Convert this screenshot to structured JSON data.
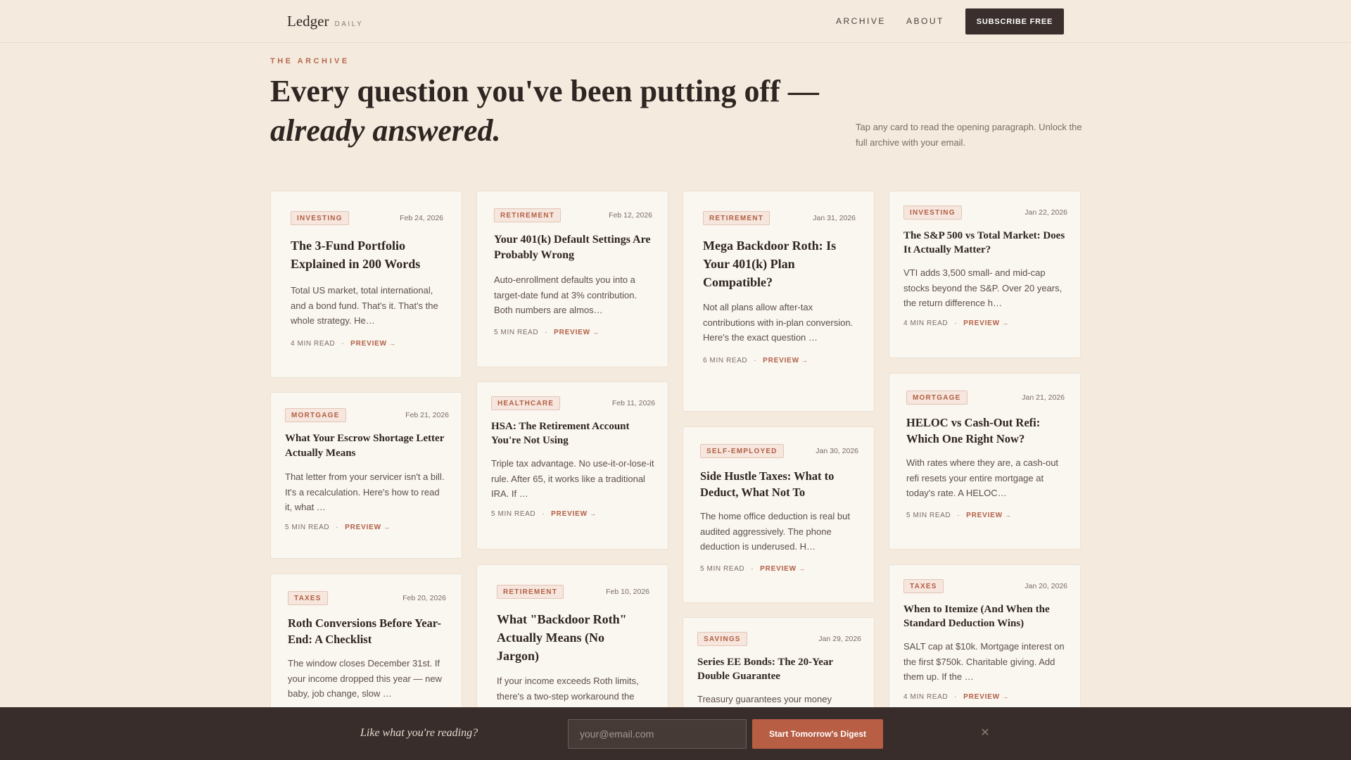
{
  "header": {
    "brand": "Ledger",
    "brand_sub": "DAILY",
    "nav": [
      "ARCHIVE",
      "ABOUT"
    ],
    "subscribe_label": "SUBSCRIBE FREE"
  },
  "hero": {
    "eyebrow": "THE ARCHIVE",
    "title_line1": "Every question you've been putting off —",
    "title_line2": "already answered.",
    "description": "Tap any card to read the opening paragraph. Unlock the full archive with your email."
  },
  "cards": [
    {
      "tag": "INVESTING",
      "date": "Feb 24, 2026",
      "title": "The 3-Fund Portfolio Explained in 200 Words",
      "excerpt": "Total US market, total international, and a bond fund. That's it. That's the whole strategy. He…",
      "read_time": "4 MIN READ",
      "preview": "PREVIEW"
    },
    {
      "tag": "MORTGAGE",
      "date": "Feb 21, 2026",
      "title": "What Your Escrow Shortage Letter Actually Means",
      "excerpt": "That letter from your servicer isn't a bill. It's a recalculation. Here's how to read it, what …",
      "read_time": "5 MIN READ",
      "preview": "PREVIEW"
    },
    {
      "tag": "TAXES",
      "date": "Feb 20, 2026",
      "title": "Roth Conversions Before Year-End: A Checklist",
      "excerpt": "The window closes December 31st. If your income dropped this year — new baby, job change, slow …",
      "read_time": "",
      "preview": ""
    },
    {
      "tag": "RETIREMENT",
      "date": "Feb 12, 2026",
      "title": "Your 401(k) Default Settings Are Probably Wrong",
      "excerpt": "Auto-enrollment defaults you into a target-date fund at 3% contribution. Both numbers are almos…",
      "read_time": "5 MIN READ",
      "preview": "PREVIEW"
    },
    {
      "tag": "HEALTHCARE",
      "date": "Feb 11, 2026",
      "title": "HSA: The Retirement Account You're Not Using",
      "excerpt": "Triple tax advantage. No use-it-or-lose-it rule. After 65, it works like a traditional IRA. If …",
      "read_time": "5 MIN READ",
      "preview": "PREVIEW"
    },
    {
      "tag": "RETIREMENT",
      "date": "Feb 10, 2026",
      "title": "What \"Backdoor Roth\" Actually Means (No Jargon)",
      "excerpt": "If your income exceeds Roth limits, there's a two-step workaround the",
      "read_time": "",
      "preview": ""
    },
    {
      "tag": "RETIREMENT",
      "date": "Jan 31, 2026",
      "title": "Mega Backdoor Roth: Is Your 401(k) Plan Compatible?",
      "excerpt": "Not all plans allow after-tax contributions with in-plan conversion. Here's the exact question …",
      "read_time": "6 MIN READ",
      "preview": "PREVIEW"
    },
    {
      "tag": "SELF-EMPLOYED",
      "date": "Jan 30, 2026",
      "title": "Side Hustle Taxes: What to Deduct, What Not To",
      "excerpt": "The home office deduction is real but audited aggressively. The phone deduction is underused. H…",
      "read_time": "5 MIN READ",
      "preview": "PREVIEW"
    },
    {
      "tag": "SAVINGS",
      "date": "Jan 29, 2026",
      "title": "Series EE Bonds: The 20-Year Double Guarantee",
      "excerpt": "Treasury guarantees your money",
      "read_time": "",
      "preview": ""
    },
    {
      "tag": "INVESTING",
      "date": "Jan 22, 2026",
      "title": "The S&P 500 vs Total Market: Does It Actually Matter?",
      "excerpt": "VTI adds 3,500 small- and mid-cap stocks beyond the S&P. Over 20 years, the return difference h…",
      "read_time": "4 MIN READ",
      "preview": "PREVIEW"
    },
    {
      "tag": "MORTGAGE",
      "date": "Jan 21, 2026",
      "title": "HELOC vs Cash-Out Refi: Which One Right Now?",
      "excerpt": "With rates where they are, a cash-out refi resets your entire mortgage at today's rate. A HELOC…",
      "read_time": "5 MIN READ",
      "preview": "PREVIEW"
    },
    {
      "tag": "TAXES",
      "date": "Jan 20, 2026",
      "title": "When to Itemize (And When the Standard Deduction Wins)",
      "excerpt": "SALT cap at $10k. Mortgage interest on the first $750k. Charitable giving. Add them up. If the …",
      "read_time": "4 MIN READ",
      "preview": "PREVIEW"
    }
  ],
  "digest_bar": {
    "prompt": "Like what you're reading?",
    "email_placeholder": "your@email.com",
    "button_label": "Start Tomorrow's Digest",
    "close_glyph": "✕"
  },
  "colors": {
    "background": "#f4ebde",
    "accent": "#b5694d",
    "dark": "#382d2b"
  }
}
